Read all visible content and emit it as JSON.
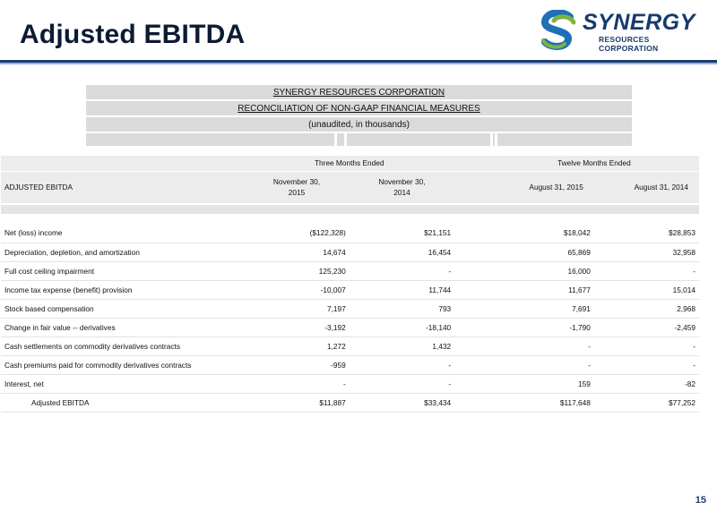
{
  "slide": {
    "title": "Adjusted EBITDA",
    "page_number": "15"
  },
  "logo": {
    "word": "SYNERGY",
    "subtitle": "RESOURCES CORPORATION",
    "icon": "swoosh-s-icon"
  },
  "header": {
    "company": "SYNERGY RESOURCES CORPORATION",
    "report": "RECONCILIATION OF NON-GAAP FINANCIAL MEASURES",
    "note": "(unaudited, in thousands)"
  },
  "table": {
    "row_header_label": "ADJUSTED EBITDA",
    "group_three_months": "Three Months Ended",
    "group_twelve_months": "Twelve Months Ended",
    "columns": [
      {
        "line1": "November 30,",
        "line2": "2015"
      },
      {
        "line1": "November 30,",
        "line2": "2014"
      },
      {
        "line1": "August 31, 2015",
        "line2": ""
      },
      {
        "line1": "August 31, 2014",
        "line2": ""
      }
    ],
    "rows": [
      {
        "label": "Net (loss) income",
        "values": [
          "($122,328)",
          "$21,151",
          "$18,042",
          "$28,853"
        ]
      },
      {
        "label": "Depreciation, depletion, and amortization",
        "values": [
          "14,674",
          "16,454",
          "65,869",
          "32,958"
        ]
      },
      {
        "label": "Full cost ceiling impairment",
        "values": [
          "125,230",
          "-",
          "16,000",
          "-"
        ]
      },
      {
        "label": "Income tax expense (benefit) provision",
        "values": [
          "-10,007",
          "11,744",
          "11,677",
          "15,014"
        ]
      },
      {
        "label": "Stock based compensation",
        "values": [
          "7,197",
          "793",
          "7,691",
          "2,968"
        ]
      },
      {
        "label": "Change in fair value -- derivatives",
        "values": [
          "-3,192",
          "-18,140",
          "-1,790",
          "-2,459"
        ]
      },
      {
        "label": "Cash settlements on commodity derivatives contracts",
        "values": [
          "1,272",
          "1,432",
          "-",
          "-"
        ]
      },
      {
        "label": "Cash premiums paid for commodity derivatives contracts",
        "values": [
          "-959",
          "-",
          "-",
          "-"
        ]
      },
      {
        "label": "Interest, net",
        "values": [
          "-",
          "-",
          "159",
          "-82"
        ]
      },
      {
        "label": "Adjusted EBITDA",
        "values": [
          "$11,887",
          "$33,434",
          "$117,648",
          "$77,252"
        ]
      }
    ]
  },
  "colors": {
    "title": "#0d1a33",
    "brand_navy": "#173a6e",
    "brand_green": "#7cb342",
    "brand_blue": "#1e6fb8",
    "rule": "#1d3f73",
    "header_fill": "#dadada",
    "table_header_fill": "#ececec"
  }
}
